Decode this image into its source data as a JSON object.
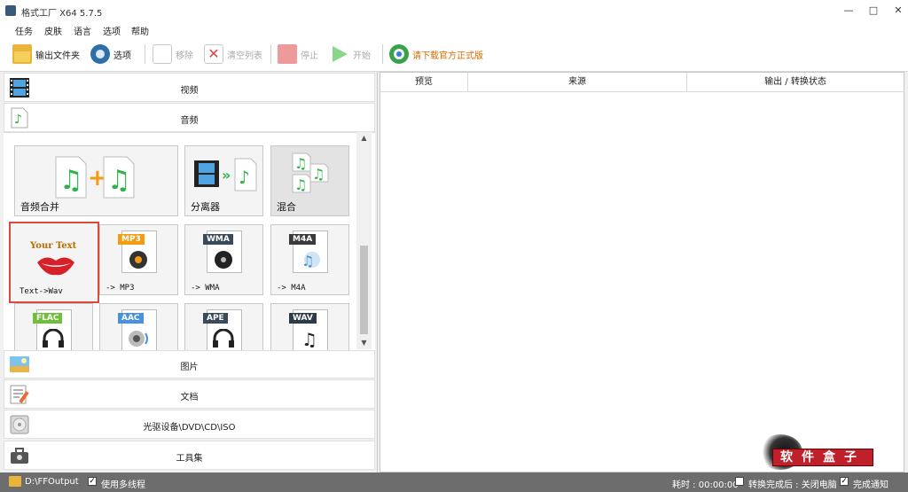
{
  "window": {
    "title": "格式工厂 X64 5.7.5",
    "minimize": "—",
    "maximize": "□",
    "close": "✕"
  },
  "menu": [
    "任务",
    "皮肤",
    "语言",
    "选项",
    "帮助"
  ],
  "toolbar": {
    "output_folder": "输出文件夹",
    "options": "选项",
    "remove": "移除",
    "clear_list": "清空列表",
    "stop": "停止",
    "start": "开始",
    "download": "请下载官方正式版"
  },
  "categories": {
    "video": "视频",
    "audio": "音频",
    "picture": "图片",
    "document": "文档",
    "rom": "光驱设备\\DVD\\CD\\ISO",
    "tools": "工具集"
  },
  "audio_tiles": [
    {
      "label": "音频合并"
    },
    {
      "label": "分离器"
    },
    {
      "label": "混合"
    },
    {
      "label": "Text->Wav"
    },
    {
      "label": "-> MP3",
      "badge": "MP3"
    },
    {
      "label": "-> WMA",
      "badge": "WMA"
    },
    {
      "label": "-> M4A",
      "badge": "M4A"
    },
    {
      "badge": "FLAC"
    },
    {
      "badge": "AAC"
    },
    {
      "badge": "APE"
    },
    {
      "badge": "WAV"
    }
  ],
  "tts_logo_text": "Your Text",
  "table": {
    "columns": [
      "预览",
      "来源",
      "输出 / 转换状态"
    ]
  },
  "status": {
    "output_path": "D:\\FFOutput",
    "multithread": "使用多线程",
    "elapsed": "耗时 : 00:00:00",
    "shutdown": "转换完成后 : 关闭电脑",
    "notify": "完成通知",
    "check": "✓"
  },
  "watermark": "软件盒子"
}
